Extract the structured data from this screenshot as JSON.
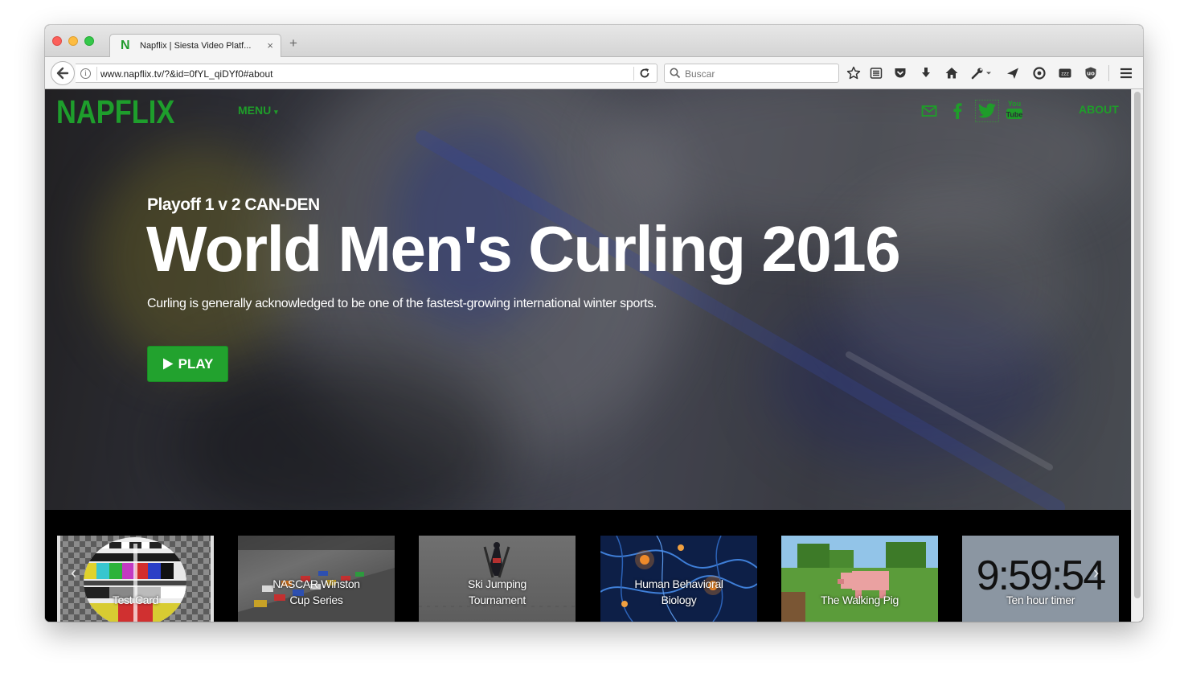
{
  "browser": {
    "tab": {
      "favicon": "N",
      "title": "Napflix | Siesta Video Platf...",
      "close": "×"
    },
    "new_tab": "+",
    "url": "www.napflix.tv/?&id=0fYL_qiDYf0#about",
    "info_glyph": "i",
    "search_placeholder": "Buscar"
  },
  "site": {
    "brand": "NAPFLIX",
    "menu_label": "MENU",
    "menu_caret": "▾",
    "about_label": "ABOUT",
    "accent_color": "#1f9d2a"
  },
  "hero": {
    "subtitle": "Playoff 1 v 2 CAN-DEN",
    "title": "World Men's Curling 2016",
    "description": "Curling is generally acknowledged to be one of the fastest-growing international winter sports.",
    "play_label": "PLAY"
  },
  "carousel": {
    "prev": "‹",
    "next": "›",
    "items": [
      {
        "label": "Test Card"
      },
      {
        "label_lines": [
          "NASCAR Winston",
          "Cup Series"
        ]
      },
      {
        "label_lines": [
          "Ski Jumping",
          "Tournament"
        ]
      },
      {
        "label_lines": [
          "Human Behavioral",
          "Biology"
        ]
      },
      {
        "label": "The Walking Pig"
      },
      {
        "label": "Ten hour timer",
        "time": "9:59:54"
      }
    ]
  },
  "icons": [
    "back-arrow-icon",
    "info-icon",
    "reload-icon",
    "search-icon",
    "star-icon",
    "reading-list-icon",
    "pocket-icon",
    "download-icon",
    "home-icon",
    "wrench-icon",
    "send-icon",
    "at-icon",
    "sleep-icon",
    "ublock-icon",
    "hamburger-menu-icon",
    "mail-icon",
    "facebook-icon",
    "twitter-icon",
    "youtube-icon",
    "play-icon"
  ]
}
